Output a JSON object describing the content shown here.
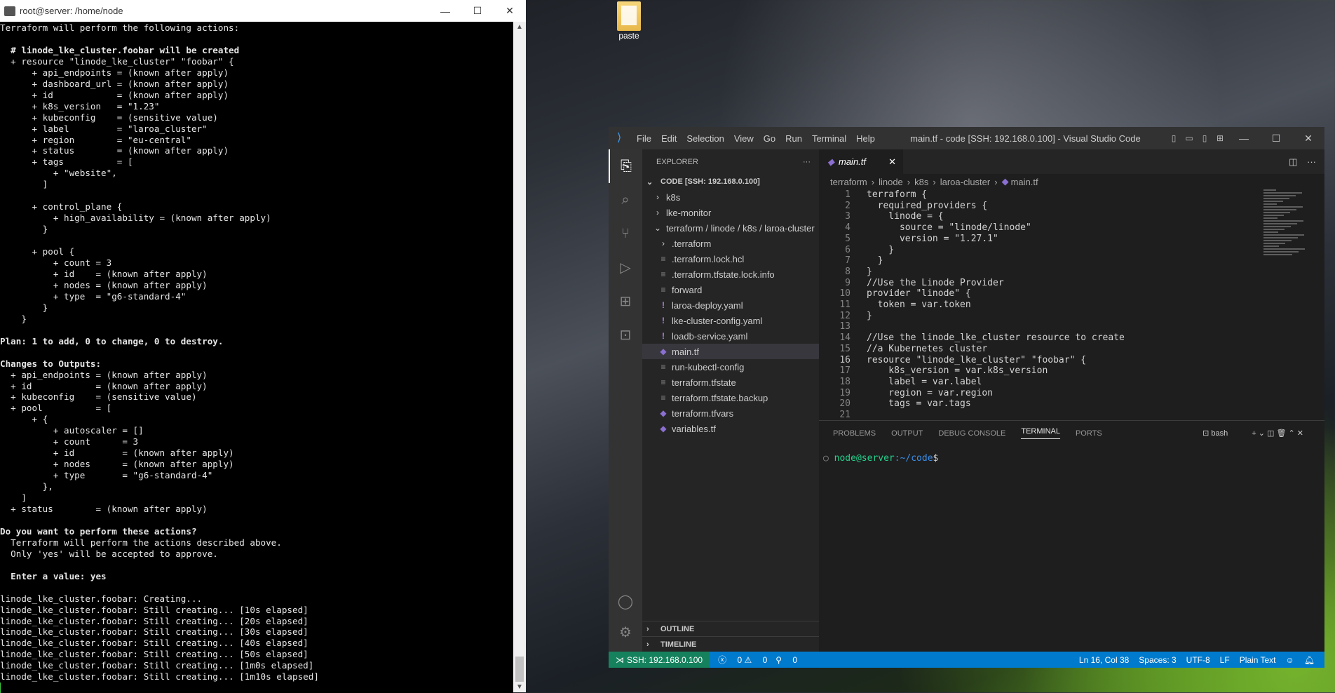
{
  "desktop": {
    "icon_label": "paste"
  },
  "putty": {
    "title": "root@server: /home/node",
    "lines": [
      "Terraform will perform the following actions:",
      "",
      "  # linode_lke_cluster.foobar will be created",
      "  + resource \"linode_lke_cluster\" \"foobar\" {",
      "      + api_endpoints = (known after apply)",
      "      + dashboard_url = (known after apply)",
      "      + id            = (known after apply)",
      "      + k8s_version   = \"1.23\"",
      "      + kubeconfig    = (sensitive value)",
      "      + label         = \"laroa_cluster\"",
      "      + region        = \"eu-central\"",
      "      + status        = (known after apply)",
      "      + tags          = [",
      "          + \"website\",",
      "        ]",
      "",
      "      + control_plane {",
      "          + high_availability = (known after apply)",
      "        }",
      "",
      "      + pool {",
      "          + count = 3",
      "          + id    = (known after apply)",
      "          + nodes = (known after apply)",
      "          + type  = \"g6-standard-4\"",
      "        }",
      "    }",
      "",
      "Plan: 1 to add, 0 to change, 0 to destroy.",
      "",
      "Changes to Outputs:",
      "  + api_endpoints = (known after apply)",
      "  + id            = (known after apply)",
      "  + kubeconfig    = (sensitive value)",
      "  + pool          = [",
      "      + {",
      "          + autoscaler = []",
      "          + count      = 3",
      "          + id         = (known after apply)",
      "          + nodes      = (known after apply)",
      "          + type       = \"g6-standard-4\"",
      "        },",
      "    ]",
      "  + status        = (known after apply)",
      "",
      "Do you want to perform these actions?",
      "  Terraform will perform the actions described above.",
      "  Only 'yes' will be accepted to approve.",
      "",
      "  Enter a value: yes",
      "",
      "linode_lke_cluster.foobar: Creating...",
      "linode_lke_cluster.foobar: Still creating... [10s elapsed]",
      "linode_lke_cluster.foobar: Still creating... [20s elapsed]",
      "linode_lke_cluster.foobar: Still creating... [30s elapsed]",
      "linode_lke_cluster.foobar: Still creating... [40s elapsed]",
      "linode_lke_cluster.foobar: Still creating... [50s elapsed]",
      "linode_lke_cluster.foobar: Still creating... [1m0s elapsed]",
      "linode_lke_cluster.foobar: Still creating... [1m10s elapsed]"
    ]
  },
  "vscode": {
    "title": "main.tf - code [SSH: 192.168.0.100] - Visual Studio Code",
    "menu": [
      "File",
      "Edit",
      "Selection",
      "View",
      "Go",
      "Run",
      "Terminal",
      "Help"
    ],
    "explorer": {
      "header": "EXPLORER",
      "root": "CODE [SSH: 192.168.0.100]",
      "items": [
        {
          "label": "k8s",
          "icon": "chevron-right",
          "indent": 1
        },
        {
          "label": "lke-monitor",
          "icon": "chevron-right",
          "indent": 1
        },
        {
          "label": "terraform / linode / k8s / laroa-cluster",
          "icon": "chevron-down",
          "indent": 1
        },
        {
          "label": ".terraform",
          "icon": "chevron-right",
          "indent": 2
        },
        {
          "label": ".terraform.lock.hcl",
          "icon": "text-file",
          "indent": 2
        },
        {
          "label": ".terraform.tfstate.lock.info",
          "icon": "text-file",
          "indent": 2
        },
        {
          "label": "forward",
          "icon": "text-file",
          "indent": 2
        },
        {
          "label": "laroa-deploy.yaml",
          "icon": "yaml-file",
          "indent": 2
        },
        {
          "label": "lke-cluster-config.yaml",
          "icon": "yaml-file",
          "indent": 2
        },
        {
          "label": "loadb-service.yaml",
          "icon": "yaml-file",
          "indent": 2
        },
        {
          "label": "main.tf",
          "icon": "terraform-file",
          "indent": 2,
          "selected": true
        },
        {
          "label": "run-kubectl-config",
          "icon": "text-file",
          "indent": 2
        },
        {
          "label": "terraform.tfstate",
          "icon": "text-file",
          "indent": 2
        },
        {
          "label": "terraform.tfstate.backup",
          "icon": "text-file",
          "indent": 2
        },
        {
          "label": "terraform.tfvars",
          "icon": "terraform-file",
          "indent": 2
        },
        {
          "label": "variables.tf",
          "icon": "terraform-file",
          "indent": 2
        }
      ],
      "outline": "OUTLINE",
      "timeline": "TIMELINE"
    },
    "tab": {
      "label": "main.tf"
    },
    "breadcrumb": [
      "terraform",
      "linode",
      "k8s",
      "laroa-cluster",
      "main.tf"
    ],
    "code_lines": [
      "terraform {",
      "  required_providers {",
      "    linode = {",
      "      source = \"linode/linode\"",
      "      version = \"1.27.1\"",
      "    }",
      "  }",
      "}",
      "//Use the Linode Provider",
      "provider \"linode\" {",
      "  token = var.token",
      "}",
      "",
      "//Use the linode_lke_cluster resource to create",
      "//a Kubernetes cluster",
      "resource \"linode_lke_cluster\" \"foobar\" {",
      "    k8s_version = var.k8s_version",
      "    label = var.label",
      "    region = var.region",
      "    tags = var.tags",
      ""
    ],
    "current_line": 16,
    "panel_tabs": [
      "PROBLEMS",
      "OUTPUT",
      "DEBUG CONSOLE",
      "TERMINAL",
      "PORTS"
    ],
    "active_panel_tab": "TERMINAL",
    "shell_name": "bash",
    "prompt_user": "node@server",
    "prompt_path": ":~/code",
    "prompt_symbol": "$",
    "status": {
      "remote": "SSH: 192.168.0.100",
      "errors": "0",
      "warnings": "0",
      "ports": "0",
      "position": "Ln 16, Col 38",
      "spaces": "Spaces: 3",
      "encoding": "UTF-8",
      "eol": "LF",
      "language": "Plain Text"
    }
  }
}
